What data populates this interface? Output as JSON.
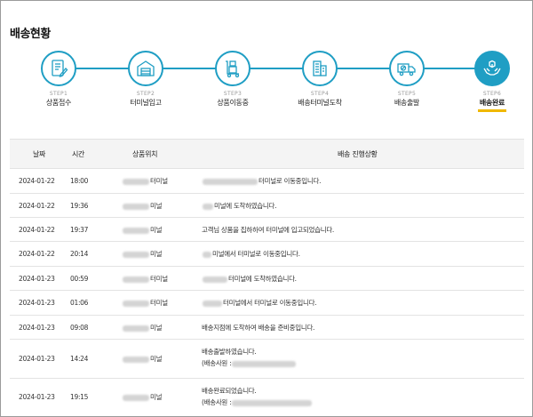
{
  "page_title": "배송현황",
  "steps": [
    {
      "num": "STEP1",
      "label": "상품접수",
      "icon": "receipt-form-icon"
    },
    {
      "num": "STEP2",
      "label": "터미널입고",
      "icon": "warehouse-icon"
    },
    {
      "num": "STEP3",
      "label": "상품이동중",
      "icon": "cart-boxes-icon"
    },
    {
      "num": "STEP4",
      "label": "배송터미널도착",
      "icon": "buildings-icon"
    },
    {
      "num": "STEP5",
      "label": "배송출발",
      "icon": "delivery-truck-icon"
    },
    {
      "num": "STEP6",
      "label": "배송완료",
      "icon": "hands-box-icon"
    }
  ],
  "active_step_index": 5,
  "colors": {
    "accent": "#1f9ec4",
    "active_underline": "#f0b800",
    "header_bg": "#f4f4f4"
  },
  "table": {
    "headers": {
      "date": "날짜",
      "time": "시간",
      "location": "상품위치",
      "status": "배송 진행상황"
    },
    "rows": [
      {
        "date": "2024-01-22",
        "time": "18:00",
        "location": "터미널",
        "status": "터미널로 이동중입니다."
      },
      {
        "date": "2024-01-22",
        "time": "19:36",
        "location": "미널",
        "status": "미널에 도착하였습니다."
      },
      {
        "date": "2024-01-22",
        "time": "19:37",
        "location": "미널",
        "status": "고객님 상품을 집하하여 터미널에 입고되었습니다."
      },
      {
        "date": "2024-01-22",
        "time": "20:14",
        "location": "미널",
        "status": "미널에서 터미널로 이동중입니다."
      },
      {
        "date": "2024-01-23",
        "time": "00:59",
        "location": "터미널",
        "status": "터미널에 도착하였습니다."
      },
      {
        "date": "2024-01-23",
        "time": "01:06",
        "location": "터미널",
        "status": "터미널에서 터미널로 이동중입니다."
      },
      {
        "date": "2024-01-23",
        "time": "09:08",
        "location": "미널",
        "status": "배송지점에 도착하여 배송을 준비중입니다."
      },
      {
        "date": "2024-01-23",
        "time": "14:24",
        "location": "미널",
        "status": "배송출발하였습니다.",
        "status2": "(배송사원 :"
      },
      {
        "date": "2024-01-23",
        "time": "19:15",
        "location": "미널",
        "status": "배송완료되었습니다.",
        "status2": "(배송사원 :"
      }
    ]
  }
}
